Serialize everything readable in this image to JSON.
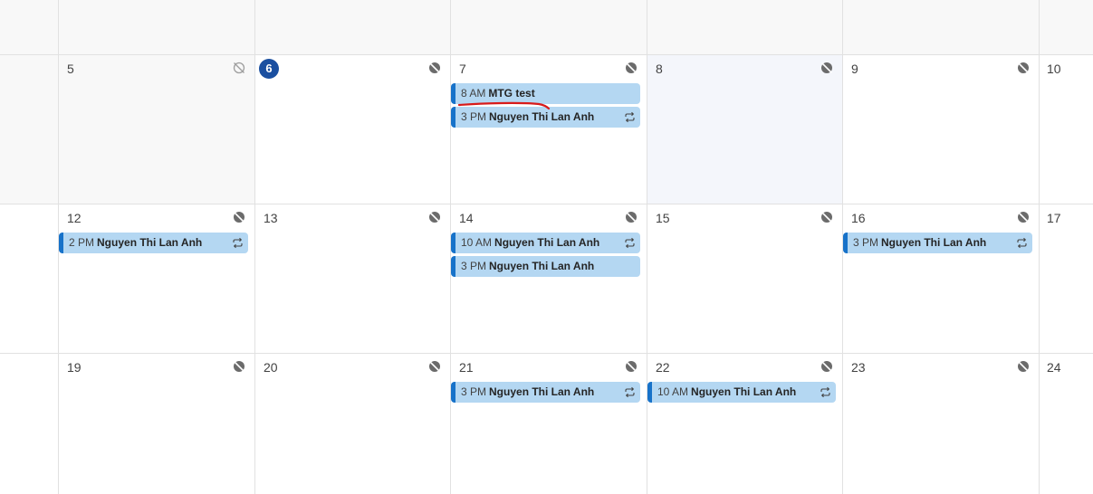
{
  "weeks": [
    {
      "days": [
        {
          "num": "5"
        },
        {
          "num": "6",
          "today": true
        },
        {
          "num": "7"
        },
        {
          "num": "8",
          "selected": true
        },
        {
          "num": "9"
        },
        {
          "num": "10"
        }
      ]
    },
    {
      "days": [
        {
          "num": "12"
        },
        {
          "num": "13"
        },
        {
          "num": "14"
        },
        {
          "num": "15"
        },
        {
          "num": "16"
        },
        {
          "num": "17"
        }
      ]
    },
    {
      "days": [
        {
          "num": "19"
        },
        {
          "num": "20"
        },
        {
          "num": "21"
        },
        {
          "num": "22"
        },
        {
          "num": "23"
        },
        {
          "num": "24"
        }
      ]
    }
  ],
  "events": {
    "w1_d7_a": {
      "time": "8 AM",
      "title": "MTG test"
    },
    "w1_d7_b": {
      "time": "3 PM",
      "title": "Nguyen Thi Lan Anh"
    },
    "w2_d12": {
      "time": "2 PM",
      "title": "Nguyen Thi Lan Anh"
    },
    "w2_d14_a": {
      "time": "10 AM",
      "title": "Nguyen Thi Lan Anh"
    },
    "w2_d14_b": {
      "time": "3 PM",
      "title": "Nguyen Thi Lan Anh"
    },
    "w2_d16": {
      "time": "3 PM",
      "title": "Nguyen Thi Lan Anh"
    },
    "w3_d21": {
      "time": "3 PM",
      "title": "Nguyen Thi Lan Anh"
    },
    "w3_d22": {
      "time": "10 AM",
      "title": "Nguyen Thi Lan Anh"
    }
  },
  "icons": {
    "weather": "weather-unavailable-icon",
    "repeat": "repeat-icon"
  },
  "colors": {
    "today_badge": "#1a4fa0",
    "event_fill": "#b4d7f2",
    "event_accent": "#1772c9",
    "annotation": "#d81b1b"
  }
}
